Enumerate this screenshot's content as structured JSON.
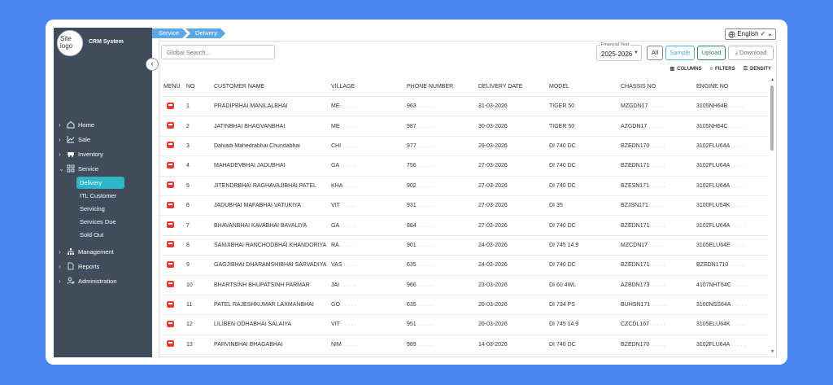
{
  "app": {
    "logo_text": "Site logo",
    "title": "CRM System"
  },
  "sidebar": {
    "items": [
      {
        "label": "Home",
        "icon": "home-icon"
      },
      {
        "label": "Sale",
        "icon": "chart-icon"
      },
      {
        "label": "Inventory",
        "icon": "truck-icon"
      },
      {
        "label": "Service",
        "icon": "grid-icon"
      }
    ],
    "service_sub": [
      {
        "label": "Delivery",
        "active": true
      },
      {
        "label": "ITL Customer"
      },
      {
        "label": "Servicing"
      },
      {
        "label": "Services Due"
      },
      {
        "label": "Sold Out"
      }
    ],
    "items_after": [
      {
        "label": "Management",
        "icon": "org-icon"
      },
      {
        "label": "Reports",
        "icon": "document-icon"
      },
      {
        "label": "Administration",
        "icon": "user-gear-icon"
      }
    ]
  },
  "breadcrumb": [
    "Service",
    "Delivery"
  ],
  "language": {
    "selected": "English"
  },
  "toolbar": {
    "search_placeholder": "Global Search...",
    "financial_year_label": "Financial Year",
    "financial_year": "2025-2026",
    "btn_all": "All",
    "btn_sample": "Sample",
    "btn_upload": "Upload",
    "btn_download": "Download",
    "columns": "COLUMNS",
    "filters": "FILTERS",
    "density": "DENSITY"
  },
  "table": {
    "headers": [
      "MENU",
      "NO",
      "CUSTOMER NAME",
      "VILLAGE",
      "PHONE NUMBER",
      "DELIVERY DATE",
      "MODEL",
      "CHASSIS NO",
      "ENGINE NO"
    ],
    "rows": [
      {
        "no": "1",
        "name": "PRADIPBHAI MANILALBHAI",
        "village": "ME",
        "phone": "963",
        "date": "31-03-2026",
        "model": "TIGER 50",
        "chassis": "MZGDN17",
        "engine": "3105NH64B"
      },
      {
        "no": "2",
        "name": "JATINBHAI BHAGVANBHAI",
        "village": "ME",
        "phone": "987",
        "date": "30-03-2026",
        "model": "TIGER 50",
        "chassis": "AZGDN17",
        "engine": "3105NH64C"
      },
      {
        "no": "3",
        "name": "Dalvadi Mahedrabhai Chundabhai",
        "village": "CHI",
        "phone": "977",
        "date": "29-03-2026",
        "model": "DI 740 DC",
        "chassis": "BZEDN170",
        "engine": "3102FLU64A"
      },
      {
        "no": "4",
        "name": "MAHADEVBHAI JADUBHAI",
        "village": "GA",
        "phone": "756",
        "date": "27-03-2026",
        "model": "DI 740 DC",
        "chassis": "BZEDN171",
        "engine": "3102FLU64A"
      },
      {
        "no": "5",
        "name": "JITENDRBHAI RAGHAVAJIBHAI PATEL",
        "village": "KHA",
        "phone": "902",
        "date": "27-03-2026",
        "model": "DI 740 DC",
        "chassis": "BZESN171",
        "engine": "3102FLU64A"
      },
      {
        "no": "6",
        "name": "JADUBHAI MAFABHAI VATUKIYA",
        "village": "VIT",
        "phone": "931",
        "date": "27-03-2026",
        "model": "DI 35",
        "chassis": "BZJSN171",
        "engine": "3100FLU54K"
      },
      {
        "no": "7",
        "name": "BHAVANBHAI KAVABHAI BAVALIYA",
        "village": "GA",
        "phone": "884",
        "date": "27-03-2026",
        "model": "DI 740 DC",
        "chassis": "BZEDN171",
        "engine": "3102FLU64A"
      },
      {
        "no": "8",
        "name": "SAMJIBHAI RANCHODBHAI KHANDORIYA",
        "village": "RA",
        "phone": "901",
        "date": "24-03-2026",
        "model": "DI 745 14.9",
        "chassis": "MZCDN17",
        "engine": "3105ELU64E"
      },
      {
        "no": "9",
        "name": "GAGJIBHAI DHARAMSHIBHAI SARVADIYA",
        "village": "VAS",
        "phone": "635",
        "date": "24-03-2026",
        "model": "DI 740 DC",
        "chassis": "BZEDN171",
        "engine": "BZEDN1710"
      },
      {
        "no": "10",
        "name": "BHARTSINH BHUPATSINH PARMAR",
        "village": "JAI",
        "phone": "966",
        "date": "23-03-2026",
        "model": "DI 60 4WL",
        "chassis": "AZBDN173",
        "engine": "4107NHT64C"
      },
      {
        "no": "11",
        "name": "PATEL RAJESHKUMAR LAXMANBHAI",
        "village": "GO",
        "phone": "635",
        "date": "20-03-2026",
        "model": "DI 734 PS",
        "chassis": "BUHSN171",
        "engine": "3100NSS64A"
      },
      {
        "no": "12",
        "name": "LILIBEN ODHABHAI SALAIYA",
        "village": "VIT",
        "phone": "951",
        "date": "20-03-2026",
        "model": "DI 745 14.9",
        "chassis": "CZCDL167",
        "engine": "3105ELU64K"
      },
      {
        "no": "13",
        "name": "PARVINBHAI BHAGABHAI",
        "village": "NIM",
        "phone": "989",
        "date": "14-03-2026",
        "model": "DI 740 DC",
        "chassis": "BZEDN170",
        "engine": "3102FLU64A"
      }
    ]
  }
}
